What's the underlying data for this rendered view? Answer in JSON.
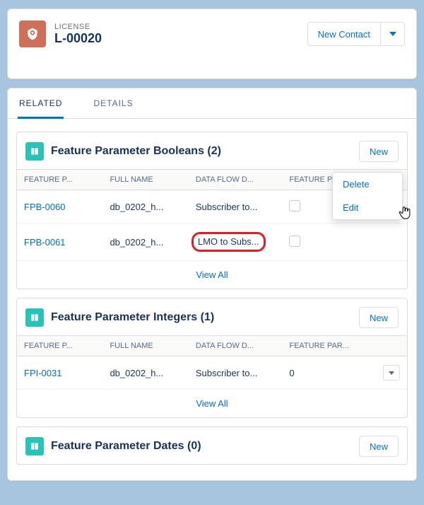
{
  "header": {
    "type_label": "LICENSE",
    "name": "L-00020",
    "primary_action": "New Contact"
  },
  "tabs": [
    {
      "label": "RELATED",
      "active": true
    },
    {
      "label": "DETAILS",
      "active": false
    }
  ],
  "related_lists": [
    {
      "title": "Feature Parameter Booleans (2)",
      "new_label": "New",
      "columns": [
        "FEATURE P...",
        "FULL NAME",
        "DATA FLOW D...",
        "FEATURE PAR..."
      ],
      "rows": [
        {
          "id": "FPB-0060",
          "full_name": "db_0202_h...",
          "data_flow": "Subscriber to...",
          "param": "checkbox"
        },
        {
          "id": "FPB-0061",
          "full_name": "db_0202_h...",
          "data_flow": "LMO to Subs...",
          "param": "checkbox"
        }
      ],
      "view_all": "View All"
    },
    {
      "title": "Feature Parameter Integers (1)",
      "new_label": "New",
      "columns": [
        "FEATURE P...",
        "FULL NAME",
        "DATA FLOW D...",
        "FEATURE PAR..."
      ],
      "rows": [
        {
          "id": "FPI-0031",
          "full_name": "db_0202_h...",
          "data_flow": "Subscriber to...",
          "param": "0"
        }
      ],
      "view_all": "View All"
    },
    {
      "title": "Feature Parameter Dates (0)",
      "new_label": "New",
      "columns": [],
      "rows": [],
      "view_all": null
    }
  ],
  "row_menu": {
    "items": [
      "Delete",
      "Edit"
    ]
  }
}
